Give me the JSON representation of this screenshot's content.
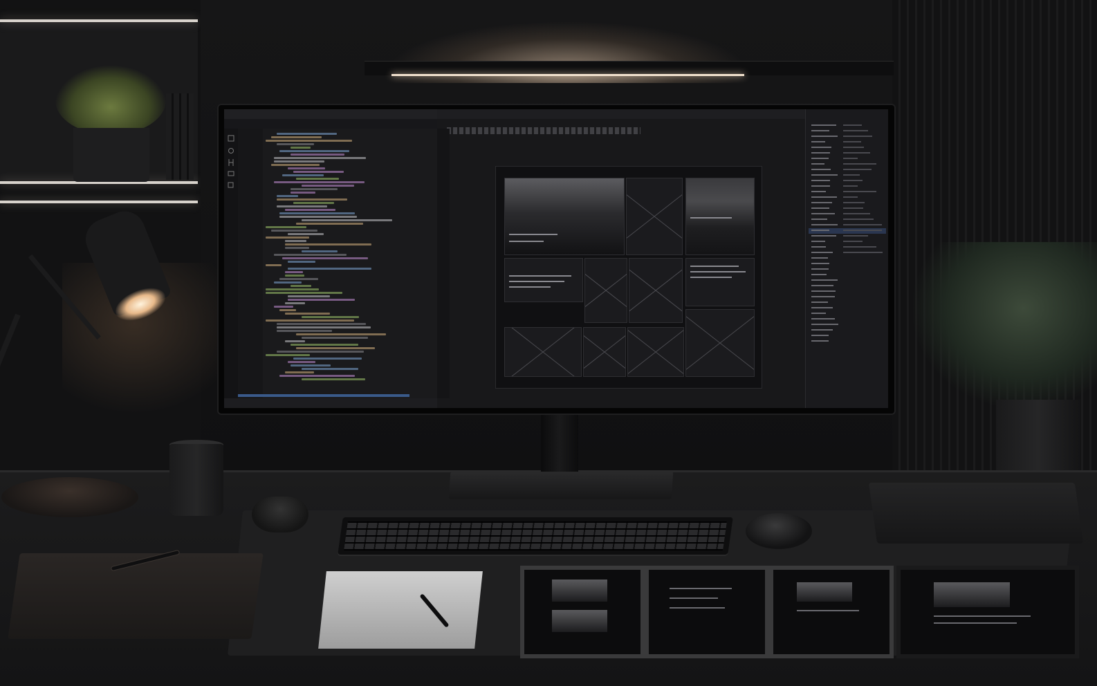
{
  "scene": {
    "description_colors": {
      "wall": "#121213",
      "desk": "#1c1c1d",
      "lamp_glow": "#e8b98a",
      "accent_blue": "#3a5a8a"
    }
  },
  "monitor": {
    "editor_pane": {
      "icons": [
        "files-icon",
        "search-icon",
        "git-icon",
        "debug-icon",
        "extensions-icon"
      ]
    },
    "preview_pane": {},
    "inspector_pane": {}
  }
}
